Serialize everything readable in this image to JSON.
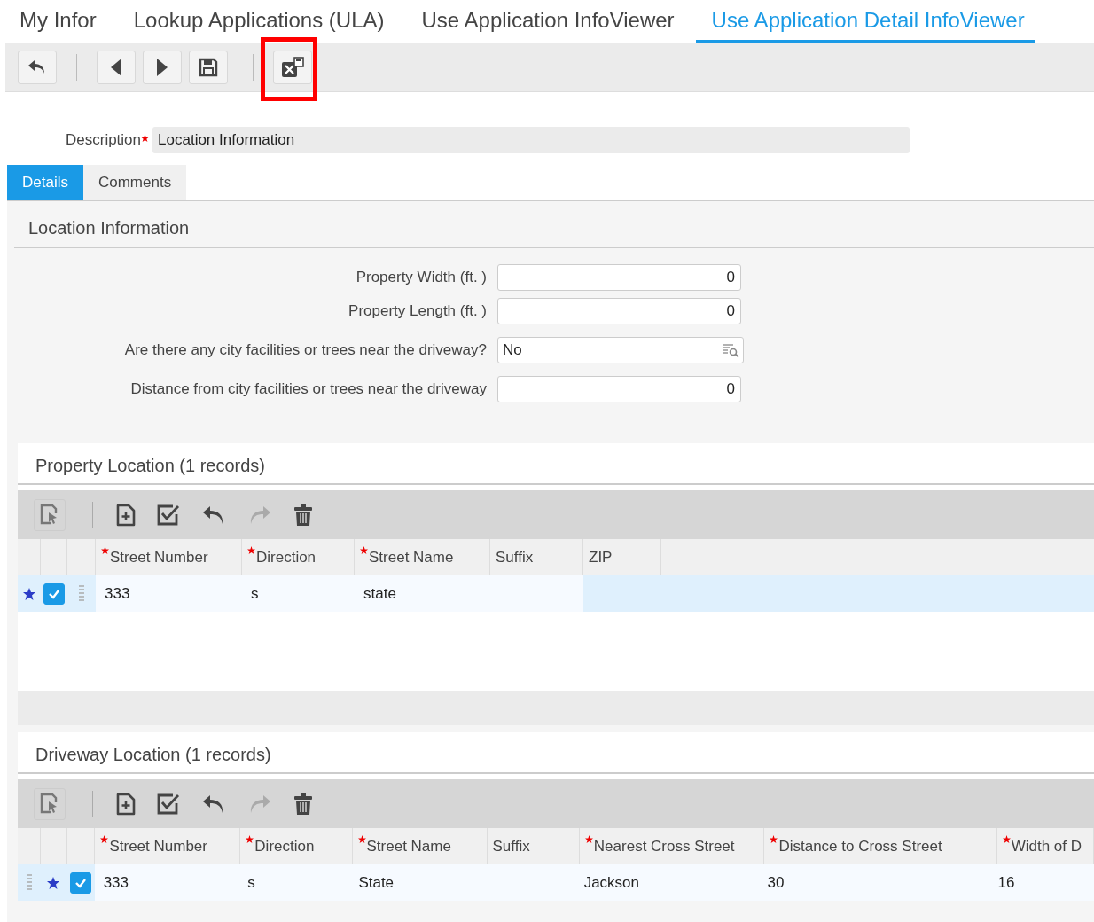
{
  "top_tabs": [
    {
      "label": "My Infor",
      "selected": false
    },
    {
      "label": "Lookup Applications (ULA)",
      "selected": false
    },
    {
      "label": "Use Application InfoViewer",
      "selected": false
    },
    {
      "label": "Use Application Detail InfoViewer",
      "selected": true
    }
  ],
  "toolbar": [
    {
      "kind": "back",
      "highlighted": false
    },
    {
      "kind": "separator"
    },
    {
      "kind": "previous",
      "highlighted": false
    },
    {
      "kind": "next",
      "highlighted": false
    },
    {
      "kind": "save",
      "highlighted": false
    },
    {
      "kind": "separator"
    },
    {
      "kind": "export",
      "highlighted": true
    }
  ],
  "description": {
    "label": "Description",
    "required": true,
    "value": "Location Information"
  },
  "tabs": [
    {
      "label": "Details",
      "selected": true
    },
    {
      "label": "Comments",
      "selected": false
    }
  ],
  "section": {
    "title": "Location Information",
    "fields": [
      {
        "label": "Property Width (ft. )",
        "value": "0",
        "kind": "number"
      },
      {
        "label": "Property Length (ft. )",
        "value": "0",
        "kind": "number"
      },
      {
        "label": "Are there any city facilities or trees near the driveway?",
        "value": "No",
        "kind": "lookup"
      },
      {
        "label": "Distance from city facilities or trees near the driveway",
        "value": "0",
        "kind": "number"
      }
    ]
  },
  "grids": [
    {
      "title": "Property Location (1 records)",
      "columns": [
        {
          "label": "Street Number",
          "required": true
        },
        {
          "label": "Direction",
          "required": true
        },
        {
          "label": "Street Name",
          "required": true
        },
        {
          "label": "Suffix",
          "required": false
        },
        {
          "label": "ZIP",
          "required": false
        }
      ],
      "rows": [
        {
          "cells": [
            "333",
            "s",
            "state",
            "",
            ""
          ],
          "checked": true
        }
      ]
    },
    {
      "title": "Driveway Location (1 records)",
      "columns": [
        {
          "label": "Street Number",
          "required": true
        },
        {
          "label": "Direction",
          "required": true
        },
        {
          "label": "Street Name",
          "required": true
        },
        {
          "label": "Suffix",
          "required": false
        },
        {
          "label": "Nearest Cross Street",
          "required": true
        },
        {
          "label": "Distance to Cross Street",
          "required": true
        },
        {
          "label": "Width of D",
          "required": true
        }
      ],
      "rows": [
        {
          "cells": [
            "333",
            "s",
            "State",
            "",
            "Jackson",
            "30",
            "16"
          ],
          "checked": true
        }
      ]
    }
  ]
}
